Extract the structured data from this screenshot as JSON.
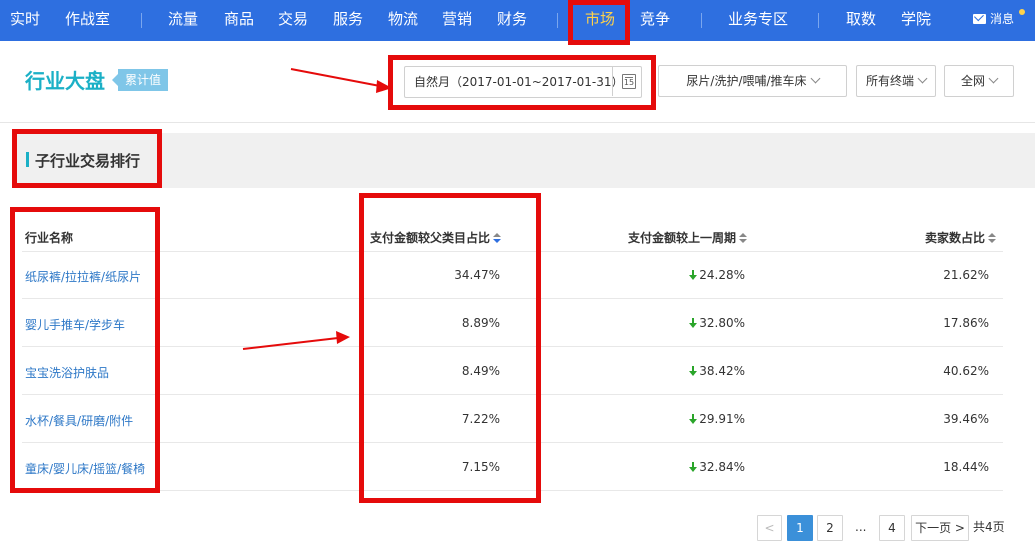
{
  "nav": {
    "items": [
      "实时",
      "作战室",
      "流量",
      "商品",
      "交易",
      "服务",
      "物流",
      "营销",
      "财务",
      "市场",
      "竞争",
      "业务专区",
      "取数",
      "学院"
    ],
    "active": "市场",
    "message": "消息"
  },
  "header": {
    "title": "行业大盘",
    "tag": "累计值",
    "date_filter": "自然月（2017-01-01~2017-01-31）",
    "calendar_day": "15",
    "category_filter": "尿片/洗护/喂哺/推车床",
    "terminal_filter": "所有终端",
    "scope_filter": "全网"
  },
  "section": {
    "title": "子行业交易排行"
  },
  "table": {
    "columns": [
      "行业名称",
      "支付金额较父类目占比",
      "支付金额较上一周期",
      "卖家数占比"
    ],
    "rows": [
      {
        "name": "纸尿裤/拉拉裤/纸尿片",
        "share": "34.47%",
        "change": "24.28%",
        "seller_share": "21.62%"
      },
      {
        "name": "婴儿手推车/学步车",
        "share": "8.89%",
        "change": "32.80%",
        "seller_share": "17.86%"
      },
      {
        "name": "宝宝洗浴护肤品",
        "share": "8.49%",
        "change": "38.42%",
        "seller_share": "40.62%"
      },
      {
        "name": "水杯/餐具/研磨/附件",
        "share": "7.22%",
        "change": "29.91%",
        "seller_share": "39.46%"
      },
      {
        "name": "童床/婴儿床/摇篮/餐椅",
        "share": "7.15%",
        "change": "32.84%",
        "seller_share": "18.44%"
      }
    ]
  },
  "pager": {
    "prev": "<",
    "pages": [
      "1",
      "2",
      "...",
      "4"
    ],
    "next": "下一页 >",
    "total": "共4页"
  },
  "colors": {
    "nav_bg": "#2e6fe0",
    "active_nav": "#ffd24a",
    "title": "#1bb0c6",
    "annotation": "#e50b0b",
    "down": "#2aa52a"
  }
}
